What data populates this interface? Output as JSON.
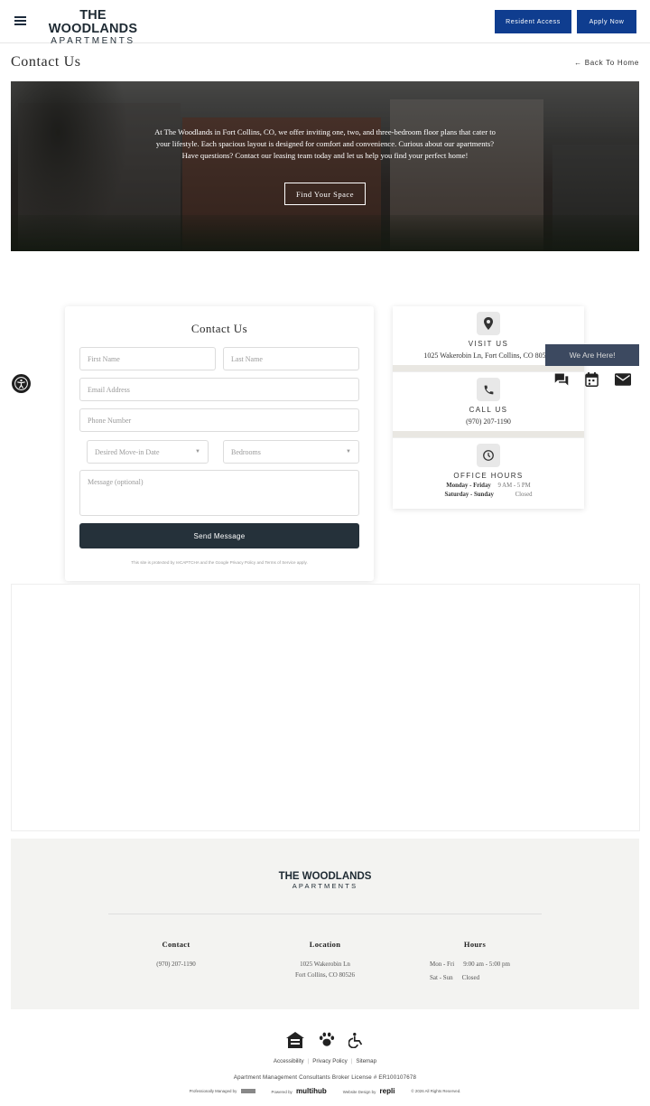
{
  "header": {
    "logo_line1": "THE WOODLANDS",
    "logo_line2": "APARTMENTS",
    "resident_access": "Resident Access",
    "apply_now": "Apply Now",
    "brand_color": "#0f3d8f"
  },
  "page": {
    "title": "Contact Us",
    "back_link": "← Back To Home"
  },
  "hero": {
    "text": "At The Woodlands in Fort Collins, CO, we offer inviting one, two, and three-bedroom floor plans that cater to your lifestyle. Each spacious layout is designed for comfort and convenience. Curious about our apartments? Have questions? Contact our leasing team today and let us help you find your perfect home!",
    "button": "Find Your Space"
  },
  "form": {
    "title": "Contact Us",
    "first_name": "First Name",
    "last_name": "Last Name",
    "email": "Email Address",
    "phone": "Phone Number",
    "move_in": "Desired Move-in Date",
    "bedrooms": "Bedrooms",
    "message": "Message (optional)",
    "send": "Send Message",
    "recaptcha_pre": "This site is protected by reCAPTCHA and the Google",
    "privacy_policy": "Privacy Policy",
    "and": "and",
    "terms": "Terms of Service",
    "apply": "apply."
  },
  "info": {
    "visit_heading": "VISIT US",
    "address": "1025 Wakerobin Ln, Fort Collins, CO 80526",
    "call_heading": "CALL US",
    "phone": "(970) 207-1190",
    "hours_heading": "OFFICE HOURS",
    "weekday_label": "Monday - Friday",
    "weekday_hours": "9 AM - 5 PM",
    "weekend_label": "Saturday - Sunday",
    "weekend_hours": "Closed"
  },
  "widget": {
    "label": "We Are Here!",
    "icons": [
      "chat-icon",
      "calendar-icon",
      "mail-icon"
    ]
  },
  "footer": {
    "logo_line1": "THE WOODLANDS",
    "logo_line2": "APARTMENTS",
    "contact_heading": "Contact",
    "contact_phone": "(970) 207-1190",
    "location_heading": "Location",
    "location_line1": "1025 Wakerobin Ln",
    "location_line2": "Fort Collins, CO 80526",
    "hours_heading": "Hours",
    "hours_row1_day": "Mon - Fri",
    "hours_row1_val": "9:00 am - 5:00 pm",
    "hours_row2_day": "Sat - Sun",
    "hours_row2_val": "Closed"
  },
  "bottom": {
    "icons": [
      "equal-housing-icon",
      "pet-friendly-icon",
      "accessibility-icon"
    ],
    "accessibility": "Accessibility",
    "privacy": "Privacy Policy",
    "sitemap": "Sitemap",
    "company_line": "Apartment Management Consultants  Broker License # ER100107678",
    "managed_by": "Professionally Managed by",
    "powered_by": "Powered by",
    "powered_brand": "multihub",
    "design_by": "Website Design by",
    "design_brand": "repli",
    "copyright": "© 2026 All Rights Reserved."
  }
}
